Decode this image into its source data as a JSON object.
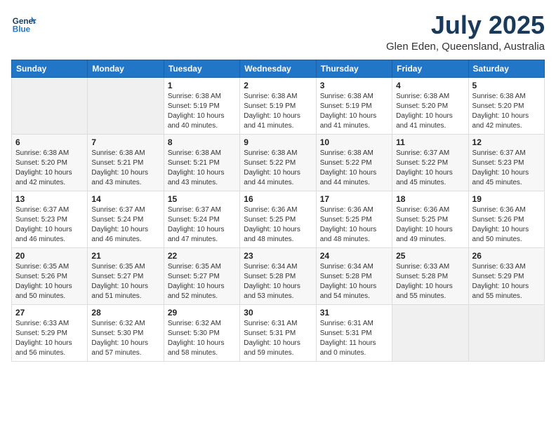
{
  "header": {
    "logo_general": "General",
    "logo_blue": "Blue",
    "month_title": "July 2025",
    "location": "Glen Eden, Queensland, Australia"
  },
  "weekdays": [
    "Sunday",
    "Monday",
    "Tuesday",
    "Wednesday",
    "Thursday",
    "Friday",
    "Saturday"
  ],
  "weeks": [
    [
      {
        "day": "",
        "info": ""
      },
      {
        "day": "",
        "info": ""
      },
      {
        "day": "1",
        "info": "Sunrise: 6:38 AM\nSunset: 5:19 PM\nDaylight: 10 hours\nand 40 minutes."
      },
      {
        "day": "2",
        "info": "Sunrise: 6:38 AM\nSunset: 5:19 PM\nDaylight: 10 hours\nand 41 minutes."
      },
      {
        "day": "3",
        "info": "Sunrise: 6:38 AM\nSunset: 5:19 PM\nDaylight: 10 hours\nand 41 minutes."
      },
      {
        "day": "4",
        "info": "Sunrise: 6:38 AM\nSunset: 5:20 PM\nDaylight: 10 hours\nand 41 minutes."
      },
      {
        "day": "5",
        "info": "Sunrise: 6:38 AM\nSunset: 5:20 PM\nDaylight: 10 hours\nand 42 minutes."
      }
    ],
    [
      {
        "day": "6",
        "info": "Sunrise: 6:38 AM\nSunset: 5:20 PM\nDaylight: 10 hours\nand 42 minutes."
      },
      {
        "day": "7",
        "info": "Sunrise: 6:38 AM\nSunset: 5:21 PM\nDaylight: 10 hours\nand 43 minutes."
      },
      {
        "day": "8",
        "info": "Sunrise: 6:38 AM\nSunset: 5:21 PM\nDaylight: 10 hours\nand 43 minutes."
      },
      {
        "day": "9",
        "info": "Sunrise: 6:38 AM\nSunset: 5:22 PM\nDaylight: 10 hours\nand 44 minutes."
      },
      {
        "day": "10",
        "info": "Sunrise: 6:38 AM\nSunset: 5:22 PM\nDaylight: 10 hours\nand 44 minutes."
      },
      {
        "day": "11",
        "info": "Sunrise: 6:37 AM\nSunset: 5:22 PM\nDaylight: 10 hours\nand 45 minutes."
      },
      {
        "day": "12",
        "info": "Sunrise: 6:37 AM\nSunset: 5:23 PM\nDaylight: 10 hours\nand 45 minutes."
      }
    ],
    [
      {
        "day": "13",
        "info": "Sunrise: 6:37 AM\nSunset: 5:23 PM\nDaylight: 10 hours\nand 46 minutes."
      },
      {
        "day": "14",
        "info": "Sunrise: 6:37 AM\nSunset: 5:24 PM\nDaylight: 10 hours\nand 46 minutes."
      },
      {
        "day": "15",
        "info": "Sunrise: 6:37 AM\nSunset: 5:24 PM\nDaylight: 10 hours\nand 47 minutes."
      },
      {
        "day": "16",
        "info": "Sunrise: 6:36 AM\nSunset: 5:25 PM\nDaylight: 10 hours\nand 48 minutes."
      },
      {
        "day": "17",
        "info": "Sunrise: 6:36 AM\nSunset: 5:25 PM\nDaylight: 10 hours\nand 48 minutes."
      },
      {
        "day": "18",
        "info": "Sunrise: 6:36 AM\nSunset: 5:25 PM\nDaylight: 10 hours\nand 49 minutes."
      },
      {
        "day": "19",
        "info": "Sunrise: 6:36 AM\nSunset: 5:26 PM\nDaylight: 10 hours\nand 50 minutes."
      }
    ],
    [
      {
        "day": "20",
        "info": "Sunrise: 6:35 AM\nSunset: 5:26 PM\nDaylight: 10 hours\nand 50 minutes."
      },
      {
        "day": "21",
        "info": "Sunrise: 6:35 AM\nSunset: 5:27 PM\nDaylight: 10 hours\nand 51 minutes."
      },
      {
        "day": "22",
        "info": "Sunrise: 6:35 AM\nSunset: 5:27 PM\nDaylight: 10 hours\nand 52 minutes."
      },
      {
        "day": "23",
        "info": "Sunrise: 6:34 AM\nSunset: 5:28 PM\nDaylight: 10 hours\nand 53 minutes."
      },
      {
        "day": "24",
        "info": "Sunrise: 6:34 AM\nSunset: 5:28 PM\nDaylight: 10 hours\nand 54 minutes."
      },
      {
        "day": "25",
        "info": "Sunrise: 6:33 AM\nSunset: 5:28 PM\nDaylight: 10 hours\nand 55 minutes."
      },
      {
        "day": "26",
        "info": "Sunrise: 6:33 AM\nSunset: 5:29 PM\nDaylight: 10 hours\nand 55 minutes."
      }
    ],
    [
      {
        "day": "27",
        "info": "Sunrise: 6:33 AM\nSunset: 5:29 PM\nDaylight: 10 hours\nand 56 minutes."
      },
      {
        "day": "28",
        "info": "Sunrise: 6:32 AM\nSunset: 5:30 PM\nDaylight: 10 hours\nand 57 minutes."
      },
      {
        "day": "29",
        "info": "Sunrise: 6:32 AM\nSunset: 5:30 PM\nDaylight: 10 hours\nand 58 minutes."
      },
      {
        "day": "30",
        "info": "Sunrise: 6:31 AM\nSunset: 5:31 PM\nDaylight: 10 hours\nand 59 minutes."
      },
      {
        "day": "31",
        "info": "Sunrise: 6:31 AM\nSunset: 5:31 PM\nDaylight: 11 hours\nand 0 minutes."
      },
      {
        "day": "",
        "info": ""
      },
      {
        "day": "",
        "info": ""
      }
    ]
  ]
}
